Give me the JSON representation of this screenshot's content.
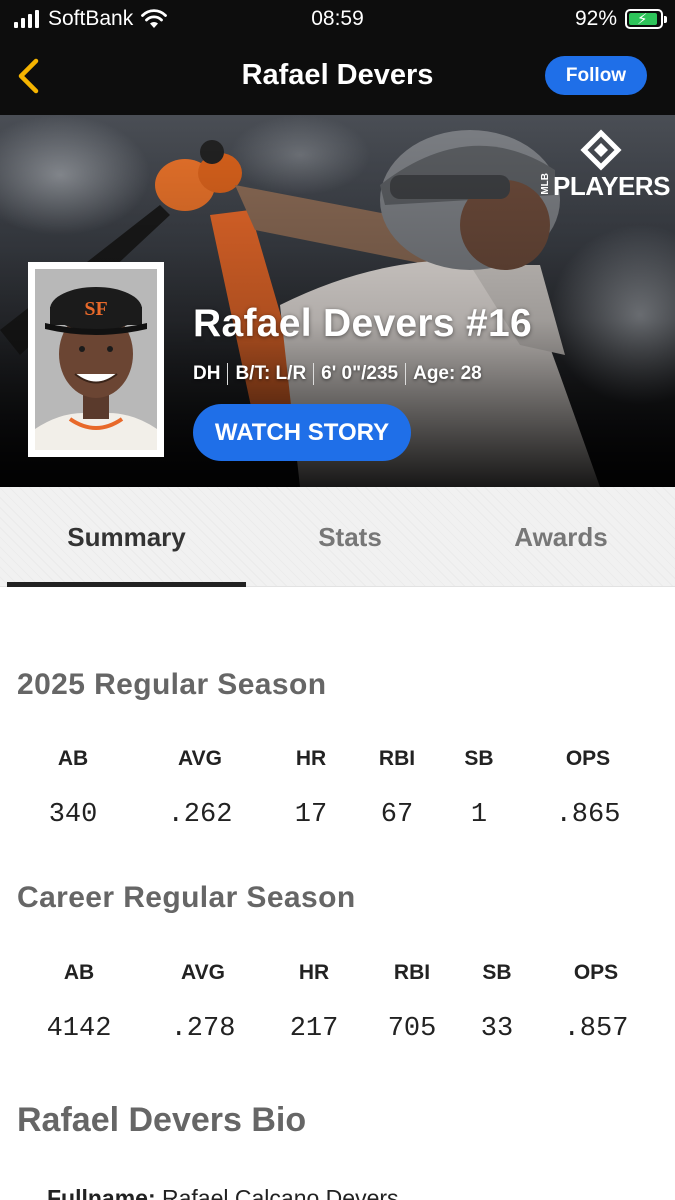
{
  "status_bar": {
    "carrier": "SoftBank",
    "time": "08:59",
    "battery": "92%",
    "battery_level": 0.92
  },
  "nav": {
    "title": "Rafael Devers",
    "follow_label": "Follow"
  },
  "hero": {
    "brand_small": "MLB",
    "brand": "PLAYERS",
    "player_name": "Rafael Devers #16",
    "meta": [
      "DH",
      "B/T: L/R",
      "6' 0\"/235",
      "Age: 28"
    ],
    "watch_label": "WATCH STORY"
  },
  "tabs": [
    {
      "label": "Summary",
      "active": true
    },
    {
      "label": "Stats",
      "active": false
    },
    {
      "label": "Awards",
      "active": false
    }
  ],
  "season": {
    "title": "2025 Regular Season",
    "headers": [
      "AB",
      "AVG",
      "HR",
      "RBI",
      "SB",
      "OPS"
    ],
    "values": [
      "340",
      ".262",
      "17",
      "67",
      "1",
      ".865"
    ]
  },
  "career": {
    "title": "Career Regular Season",
    "headers": [
      "AB",
      "AVG",
      "HR",
      "RBI",
      "SB",
      "OPS"
    ],
    "values": [
      "4142",
      ".278",
      "217",
      "705",
      "33",
      ".857"
    ]
  },
  "bio": {
    "title": "Rafael Devers Bio",
    "fullname_label": "Fullname:",
    "fullname": "Rafael Calcano Devers"
  },
  "colors": {
    "accent_blue": "#1f6fe8",
    "back_chevron": "#f5b400",
    "dark_bar": "#0d0d0d"
  }
}
